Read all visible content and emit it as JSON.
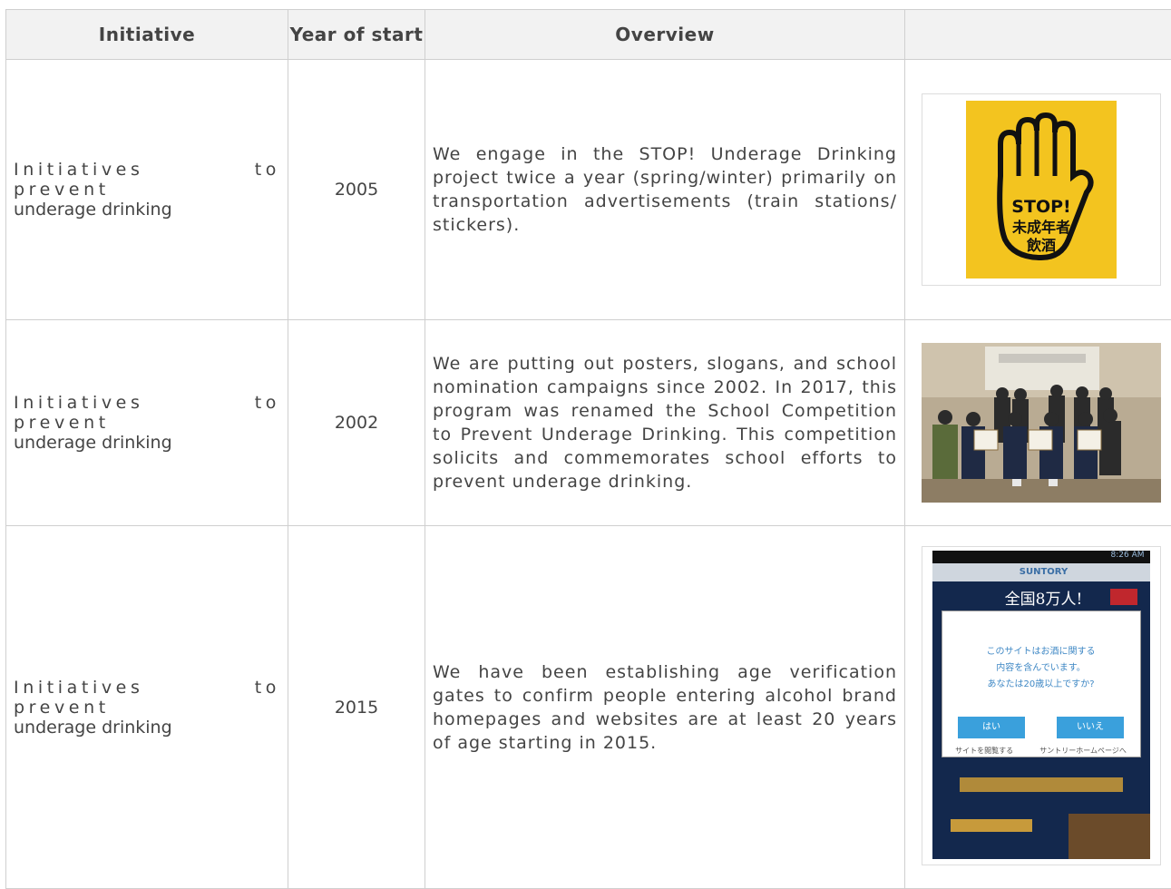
{
  "table": {
    "headers": [
      "Initiative",
      "Year of start",
      "Overview",
      ""
    ],
    "rows": [
      {
        "initiative_line1": "Initiatives to prevent",
        "initiative_line2": "underage drinking",
        "year": "2005",
        "overview": "We engage in the STOP! Underage Drinking project twice a year (spring/winter) primarily on transportation advertisements (train stations/ stickers).",
        "image": {
          "kind": "stop-sign",
          "text_en": "STOP!",
          "text_jp1": "未成年者",
          "text_jp2": "飲酒"
        }
      },
      {
        "initiative_line1": "Initiatives to prevent",
        "initiative_line2": "underage drinking",
        "year": "2002",
        "overview": "We are putting out posters, slogans, and school nomination campaigns since 2002. In 2017, this program was renamed the School Competition to Prevent Underage Drinking. This competition solicits and commemorates school efforts to prevent underage drinking.",
        "image": {
          "kind": "group-photo"
        }
      },
      {
        "initiative_line1": "Initiatives to prevent",
        "initiative_line2": "underage drinking",
        "year": "2015",
        "overview": "We have been establishing age verification gates to confirm people entering alcohol brand homepages and websites are at least 20 years of age starting in 2015.",
        "image": {
          "kind": "phone-screenshot",
          "status": "8:26 AM",
          "brand": "SUNTORY",
          "banner": "全国8万人!",
          "dialog_line1": "このサイトはお酒に関する",
          "dialog_line2": "内容を含んでいます。",
          "dialog_line3": "あなたは20歳以上ですか?",
          "yes": "はい",
          "no": "いいえ",
          "leave": "サイトを閲覧する",
          "home": "サントリーホームページへ"
        }
      }
    ]
  },
  "colors": {
    "header_bg": "#f2f2f2",
    "border": "#cfcfcf",
    "stop_yellow": "#f3c41f",
    "phone_bg": "#13284d"
  }
}
